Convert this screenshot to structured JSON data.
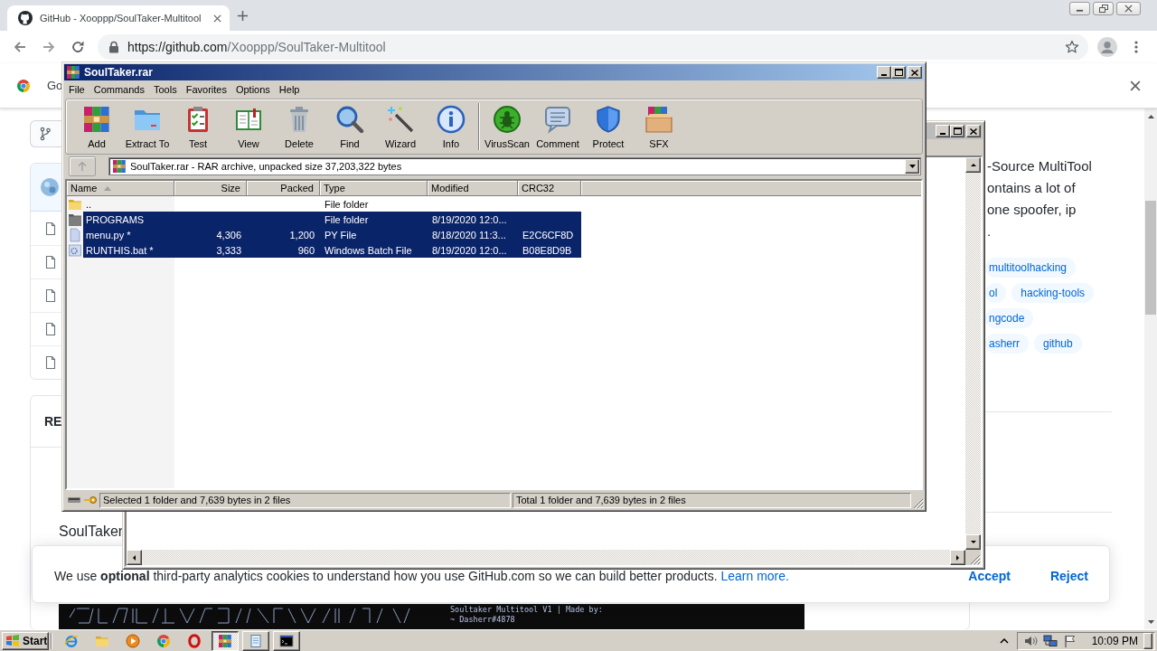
{
  "browser": {
    "tab": {
      "title": "GitHub - Xooppp/SoulTaker-Multitool"
    },
    "address": {
      "host": "https://github.com",
      "path": "/Xooppp/SoulTaker-Multitool"
    },
    "infobar": {
      "text": "Go"
    }
  },
  "page": {
    "readme": {
      "heading": "RE",
      "text": "SoulTaker"
    },
    "about": {
      "lines": [
        "-Source MultiTool",
        "ontains a lot of",
        "one spoofer, ip",
        "."
      ]
    },
    "topic_rows": [
      {
        "tags": [
          "multitoolhacking"
        ]
      },
      {
        "tags": [
          "ol",
          "hacking-tools"
        ]
      },
      {
        "tags": [
          "ngcode"
        ]
      },
      {
        "tags": [
          "asherr",
          "github"
        ]
      }
    ],
    "cookie_banner": {
      "text": "We use **optional** third-party analytics cookies to understand how you use GitHub.com so we can build better products.",
      "link": "Learn more.",
      "buttons": [
        "Accept",
        "Reject"
      ]
    },
    "terminal": {
      "lines": [
        "Soultaker Multitool V1 | Made by:",
        "~ Dasherr#4878"
      ]
    }
  },
  "archive_window": {
    "title": "SoulTaker.rar",
    "menu": [
      "File",
      "Commands",
      "Tools",
      "Favorites",
      "Options",
      "Help"
    ],
    "toolbar_groups": [
      {
        "buttons": [
          {
            "kind": "add",
            "label": "Add"
          },
          {
            "kind": "extract",
            "label": "Extract To"
          },
          {
            "kind": "test",
            "label": "Test"
          },
          {
            "kind": "view",
            "label": "View"
          },
          {
            "kind": "delete",
            "label": "Delete"
          },
          {
            "kind": "find",
            "label": "Find"
          },
          {
            "kind": "wizard",
            "label": "Wizard"
          },
          {
            "kind": "info",
            "label": "Info"
          }
        ]
      },
      {
        "buttons": [
          {
            "kind": "virusscan",
            "label": "VirusScan"
          },
          {
            "kind": "comment",
            "label": "Comment"
          },
          {
            "kind": "protect",
            "label": "Protect"
          },
          {
            "kind": "sfx",
            "label": "SFX"
          }
        ]
      }
    ],
    "path": "SoulTaker.rar - RAR archive, unpacked size 37,203,322 bytes",
    "columns": [
      {
        "label": "Name",
        "sorted": true
      },
      {
        "label": "Size",
        "kind": "numeric",
        "sorted": false
      },
      {
        "label": "Packed",
        "kind": "numeric",
        "sorted": false
      },
      {
        "label": "Type",
        "sorted": false
      },
      {
        "label": "Modified",
        "sorted": false
      },
      {
        "label": "CRC32",
        "sorted": false
      }
    ],
    "rows": [
      {
        "kind": "parent",
        "selected": false,
        "cells": [
          "..",
          null,
          null,
          "File folder",
          null,
          null
        ]
      },
      {
        "kind": "folder",
        "selected": true,
        "cells": [
          "PROGRAMS",
          null,
          null,
          "File folder",
          "8/19/2020 12:0...",
          null
        ]
      },
      {
        "kind": "file",
        "selected": true,
        "cells": [
          "menu.py *",
          "4,306",
          "1,200",
          "PY File",
          "8/18/2020 11:3...",
          "E2C6CF8D"
        ]
      },
      {
        "kind": "script",
        "selected": true,
        "cells": [
          "RUNTHIS.bat *",
          "3,333",
          "960",
          "Windows Batch File",
          "8/19/2020 12:0...",
          "B08E8D9B"
        ]
      }
    ],
    "status": {
      "selection": "Selected 1 folder and 7,639 bytes in 2 files",
      "total": "Total 1 folder and 7,639 bytes in 2 files"
    }
  },
  "taskbar": {
    "start": "Start",
    "quick_launch": [
      {
        "kind": "web-e"
      },
      {
        "kind": "folder"
      },
      {
        "kind": "media"
      },
      {
        "kind": "round-browser"
      },
      {
        "kind": "ring"
      }
    ],
    "tasks": [
      {
        "kind": "archiver",
        "selected": true
      },
      {
        "kind": "notepad",
        "selected": false
      },
      {
        "kind": "console",
        "selected": false
      }
    ],
    "clock": "10:09 PM"
  }
}
